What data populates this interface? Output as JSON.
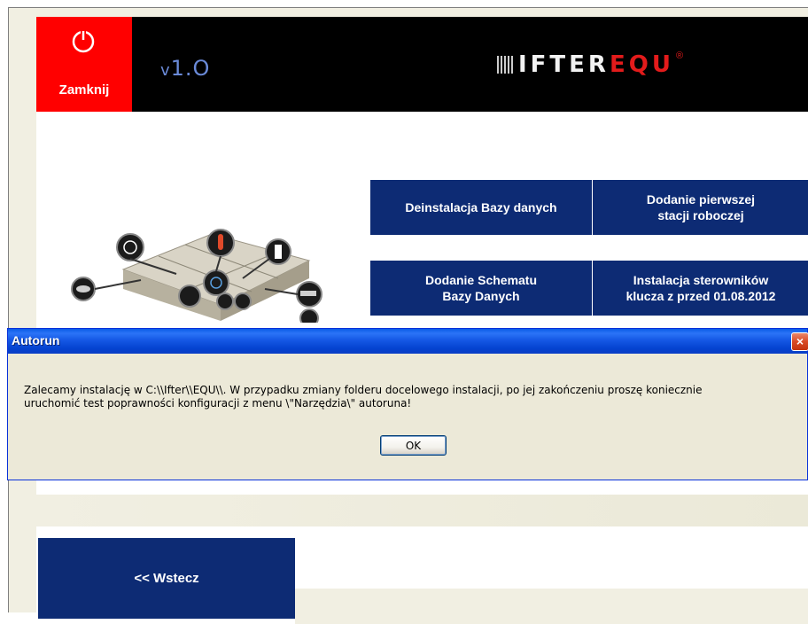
{
  "header": {
    "close_label": "Zamknij",
    "version": "1.O",
    "version_prefix": "v",
    "logo_white": "IFTER",
    "logo_red": "EQU",
    "logo_reg": "®"
  },
  "tiles": {
    "uninstall_db": "Deinstalacja Bazy danych",
    "add_first_station_line1": "Dodanie pierwszej",
    "add_first_station_line2": "stacji roboczej",
    "add_schema_line1": "Dodanie Schematu",
    "add_schema_line2": "Bazy Danych",
    "install_drivers_line1": "Instalacja sterowników",
    "install_drivers_line2": "klucza z przed 01.08.2012"
  },
  "navigation": {
    "back_label": "<< Wstecz"
  },
  "dialog": {
    "title": "Autorun",
    "close_glyph": "×",
    "message_line1": "Zalecamy instalację w C:\\\\Ifter\\\\EQU\\\\. W przypadku zmiany folderu docelowego instalacji, po jej zakończeniu proszę koniecznie",
    "message_line2": "uruchomić test poprawności konfiguracji z menu \\\"Narzędzia\\\" autoruna!",
    "ok_label": "OK"
  },
  "colors": {
    "tile_blue": "#0d2b74",
    "close_red": "#ff0000",
    "header_black": "#000000",
    "dialog_bg": "#ece9d8",
    "titlebar_blue": "#0a5be6"
  },
  "icons": [
    "power-icon",
    "ifter-logo-icon",
    "building-illustration",
    "dialog-close-icon"
  ]
}
